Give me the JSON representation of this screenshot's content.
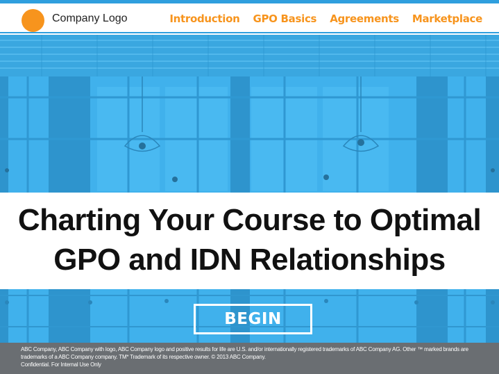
{
  "header": {
    "logo_text": "Company Logo",
    "nav": [
      {
        "label": "Introduction"
      },
      {
        "label": "GPO Basics"
      },
      {
        "label": "Agreements"
      },
      {
        "label": "Marketplace"
      }
    ]
  },
  "hero": {
    "title_line1": "Charting Your Course to Optimal",
    "title_line2": "GPO and IDN Relationships",
    "begin_label": "BEGIN"
  },
  "footer": {
    "legal_text": "ABC Company, ABC Company with logo, ABC Company logo and positive results for life are U.S. and/or internationally registered trademarks of ABC Company AG. Other ™ marked brands are trademarks of a ABC Company company. TM* Trademark of its respective owner. © 2013 ABC Company.",
    "confidential_text": "Confidential. For Internal Use Only"
  },
  "colors": {
    "accent_orange": "#f7941d",
    "brand_blue": "#3eaeeb",
    "footer_gray": "#6a6e72"
  },
  "icons": {
    "logo": "orange-circle-logo"
  }
}
